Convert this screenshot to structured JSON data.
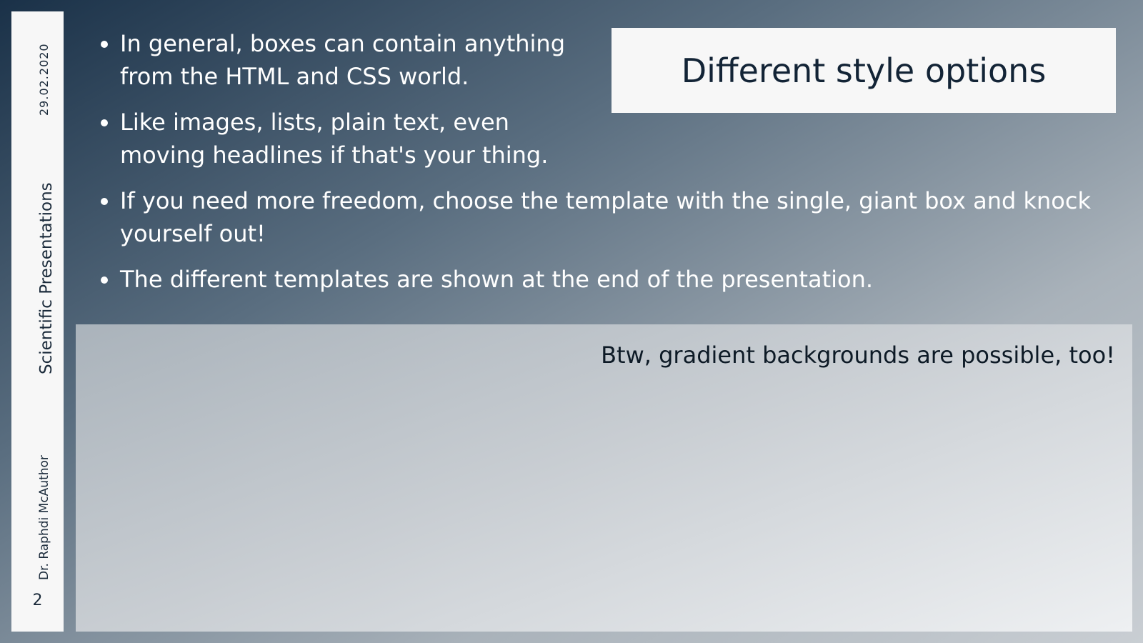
{
  "sidebar": {
    "date": "29.02.2020",
    "title": "Scientific Presentations",
    "author": "Dr. Raphdi McAuthor",
    "page_number": "2"
  },
  "slide_title": "Different style options",
  "bullets": [
    "In general, boxes can contain anything from the HTML and CSS world.",
    "Like images, lists, plain text, even moving headlines if that's your thing.",
    "If you need more freedom, choose the template with the single, giant box and knock yourself out!",
    "The different templates are shown at the end of the presentation."
  ],
  "lower_box": {
    "note": "Btw, gradient backgrounds are possible, too!"
  }
}
